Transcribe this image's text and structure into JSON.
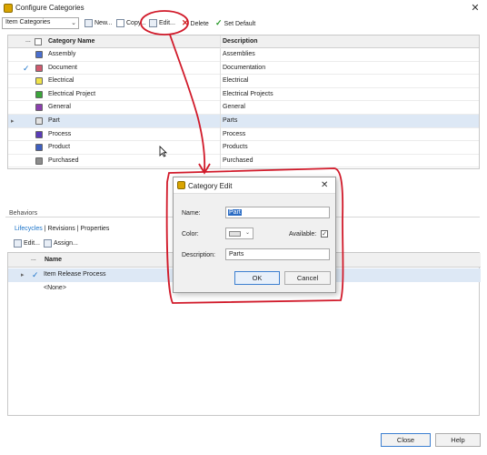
{
  "window": {
    "title": "Configure Categories",
    "close_glyph": "✕"
  },
  "toolbar": {
    "combo_value": "Item Categories",
    "new_label": "New...",
    "copy_label": "Copy...",
    "edit_label": "Edit...",
    "delete_label": "Delete",
    "set_default_label": "Set Default"
  },
  "categories_grid": {
    "col_name": "Category Name",
    "col_description": "Description",
    "rows": [
      {
        "name": "Assembly",
        "description": "Assemblies",
        "color": "#4a6fcf",
        "default": false,
        "selected": false
      },
      {
        "name": "Document",
        "description": "Documentation",
        "color": "#d05a6e",
        "default": true,
        "selected": false
      },
      {
        "name": "Electrical",
        "description": "Electrical",
        "color": "#f0e34a",
        "default": false,
        "selected": false
      },
      {
        "name": "Electrical Project",
        "description": "Electrical Projects",
        "color": "#3ba53b",
        "default": false,
        "selected": false
      },
      {
        "name": "General",
        "description": "General",
        "color": "#8b3fae",
        "default": false,
        "selected": false
      },
      {
        "name": "Part",
        "description": "Parts",
        "color": "#e2e2e2",
        "default": false,
        "selected": true
      },
      {
        "name": "Process",
        "description": "Process",
        "color": "#5a3cb8",
        "default": false,
        "selected": false
      },
      {
        "name": "Product",
        "description": "Products",
        "color": "#3f5fc0",
        "default": false,
        "selected": false
      },
      {
        "name": "Purchased",
        "description": "Purchased",
        "color": "#8c8c8c",
        "default": false,
        "selected": false
      }
    ]
  },
  "behaviors": {
    "label": "Behaviors",
    "tabs": [
      "Lifecycles",
      "Revisions",
      "Properties"
    ],
    "edit_label": "Edit...",
    "assign_label": "Assign...",
    "col_name": "Name",
    "rows": [
      "Item Release Process",
      "<None>"
    ]
  },
  "footer": {
    "close_label": "Close",
    "help_label": "Help"
  },
  "dialog": {
    "title": "Category Edit",
    "name_label": "Name:",
    "name_value": "Part",
    "color_label": "Color:",
    "available_label": "Available:",
    "description_label": "Description:",
    "description_value": "Parts",
    "ok_label": "OK",
    "cancel_label": "Cancel"
  }
}
